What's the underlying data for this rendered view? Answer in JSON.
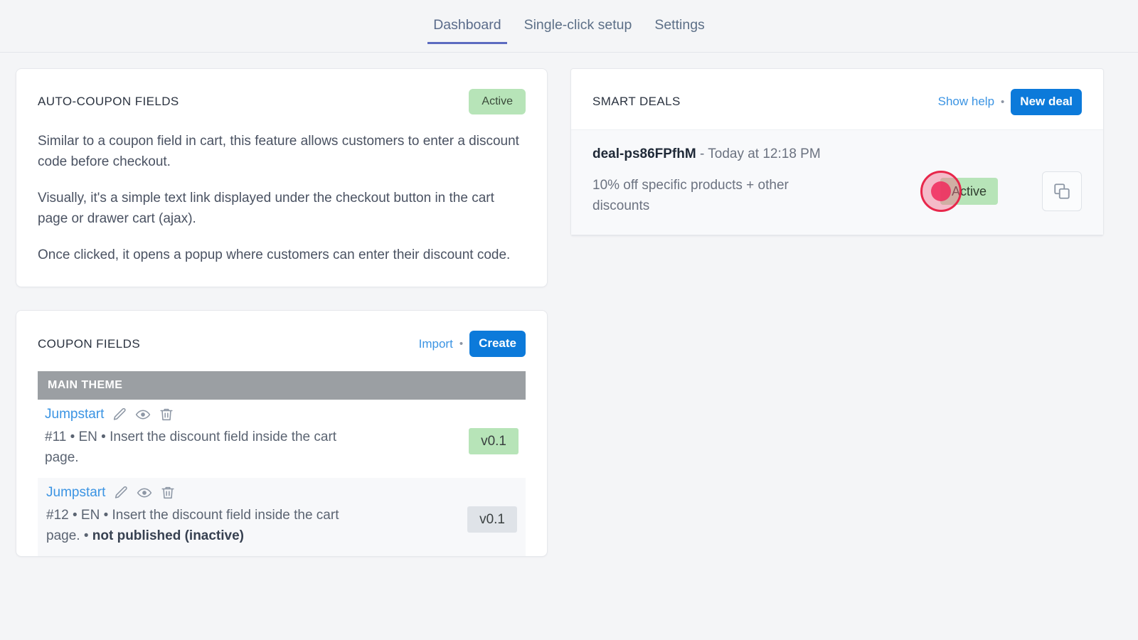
{
  "nav": {
    "tabs": [
      {
        "label": "Dashboard",
        "active": true
      },
      {
        "label": "Single-click setup",
        "active": false
      },
      {
        "label": "Settings",
        "active": false
      }
    ]
  },
  "auto_coupon_card": {
    "title": "AUTO-COUPON FIELDS",
    "status_badge": "Active",
    "paragraphs": [
      "Similar to a coupon field in cart, this feature allows customers to enter a discount code before checkout.",
      "Visually, it's a simple text link displayed under the checkout button in the cart page or drawer cart (ajax).",
      "Once clicked, it opens a popup where customers can enter their discount code."
    ]
  },
  "smart_deals_card": {
    "title": "SMART DEALS",
    "show_help_label": "Show help",
    "separator": "•",
    "new_deal_label": "New deal",
    "deals": [
      {
        "name": "deal-ps86FPfhM",
        "timestamp_prefix": " - ",
        "timestamp": "Today at 12:18 PM",
        "description": "10% off specific products + other discounts",
        "status": "Active",
        "duplicate_icon": "copy-icon"
      }
    ]
  },
  "coupon_fields_card": {
    "title": "COUPON FIELDS",
    "import_label": "Import",
    "separator": "•",
    "create_label": "Create",
    "theme_group": "MAIN THEME",
    "rows": [
      {
        "link": "Jumpstart",
        "icons": [
          "edit-icon",
          "preview-icon",
          "delete-icon"
        ],
        "description": "#11 • EN • Insert the discount field inside the cart page.",
        "description_bold": "",
        "version": "v0.1",
        "version_style": "green"
      },
      {
        "link": "Jumpstart",
        "icons": [
          "edit-icon",
          "preview-icon",
          "delete-icon"
        ],
        "description": "#12 • EN • Insert the discount field inside the cart page. • ",
        "description_bold": "not published (inactive)",
        "version": "v0.1",
        "version_style": "gray"
      }
    ]
  },
  "colors": {
    "accent_tab": "#5c6bc0",
    "link_blue": "#3b94e3",
    "primary_button": "#0c7ada",
    "badge_green": "#b7e4b8",
    "badge_gray": "#dfe3e8",
    "theme_bar_gray": "#9b9fa3",
    "page_background": "#f4f5f7",
    "click_indicator": "#e8274b"
  }
}
